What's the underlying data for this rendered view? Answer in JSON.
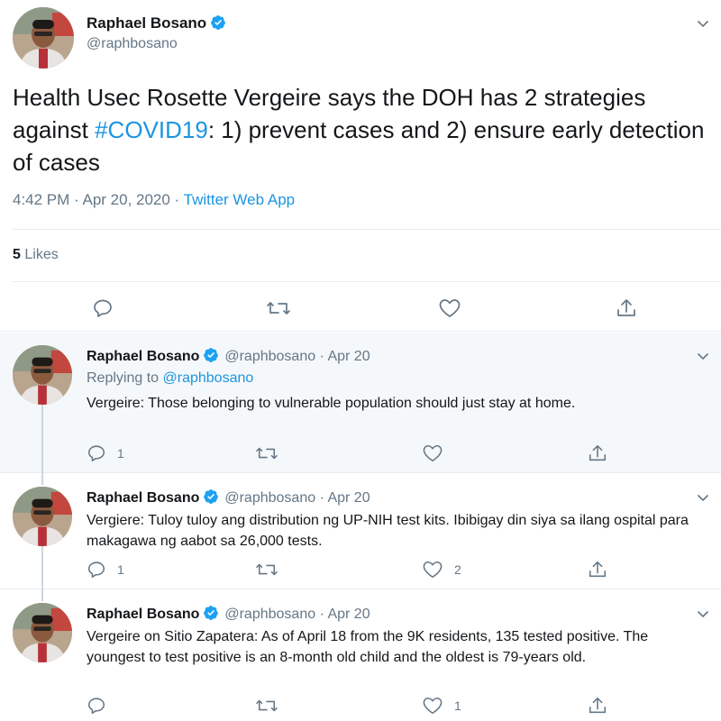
{
  "main_tweet": {
    "author_name": "Raphael Bosano",
    "author_handle": "@raphbosano",
    "text_before": "Health Usec Rosette Vergeire says the DOH has 2 strategies against ",
    "hashtag": "#COVID19",
    "text_after": ": 1) prevent cases and 2) ensure early detection of cases",
    "timestamp": "4:42 PM · Apr 20, 2020 · ",
    "source": "Twitter Web App",
    "likes_count": "5",
    "likes_label": "Likes"
  },
  "replies": [
    {
      "author_name": "Raphael Bosano",
      "meta": "@raphbosano · Apr 20",
      "replying_prefix": "Replying to ",
      "replying_handle": "@raphbosano",
      "text": "Vergeire: Those belonging to vulnerable population should just stay at home.",
      "reply_count": "1",
      "retweet_count": "",
      "like_count": ""
    },
    {
      "author_name": "Raphael Bosano",
      "meta": "@raphbosano · Apr 20",
      "text": "Vergiere: Tuloy tuloy ang distribution ng UP-NIH test kits. Ibibigay din siya sa ilang ospital para makagawa ng aabot sa 26,000 tests.",
      "reply_count": "1",
      "retweet_count": "",
      "like_count": "2"
    },
    {
      "author_name": "Raphael Bosano",
      "meta": "@raphbosano · Apr 20",
      "text": "Vergeire on Sitio Zapatera: As of April 18 from the 9K residents, 135 tested positive. The youngest to test positive is an 8-month old child and the oldest is 79-years old.",
      "reply_count": "",
      "retweet_count": "",
      "like_count": "1"
    }
  ],
  "colors": {
    "link_blue": "#1b95e0",
    "secondary_text": "#657786",
    "primary_text": "#14171a",
    "reply_highlight_bg": "#f5f8fa",
    "divider": "#e6ecf0"
  },
  "icons": [
    "verified-badge-icon",
    "chevron-down-icon",
    "reply-icon",
    "retweet-icon",
    "like-icon",
    "share-icon"
  ]
}
